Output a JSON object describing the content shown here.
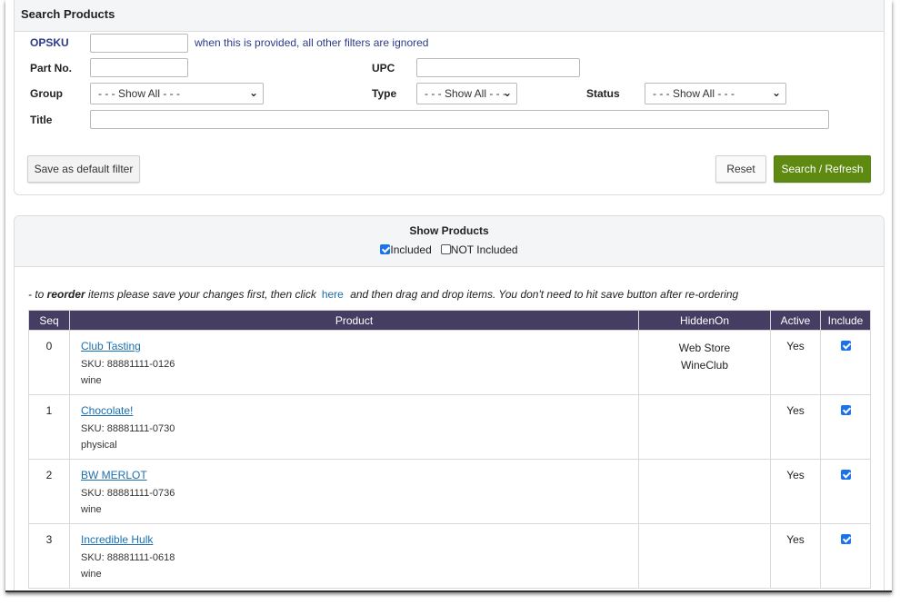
{
  "search": {
    "title": "Search Products",
    "opsku_label": "OPSKU",
    "opsku_value": "",
    "opsku_hint": "when this is provided, all other filters are ignored",
    "partno_label": "Part No.",
    "partno_value": "",
    "upc_label": "UPC",
    "upc_value": "",
    "group_label": "Group",
    "group_value": "- - - Show All - - -",
    "type_label": "Type",
    "type_value": "- - - Show All - - -",
    "status_label": "Status",
    "status_value": "- - - Show All - - -",
    "title_label": "Title",
    "title_value": "",
    "save_default_label": "Save as default filter",
    "reset_label": "Reset",
    "search_refresh_label": "Search / Refresh"
  },
  "products": {
    "title": "Show Products",
    "included_label": "Included",
    "included_checked": true,
    "not_included_label": "NOT Included",
    "not_included_checked": false,
    "reorder_prefix": "- to ",
    "reorder_bold": "reorder",
    "reorder_mid": " items please save your changes first, then click",
    "reorder_link": "here",
    "reorder_suffix": " and then drag and drop items. You don't need to hit save button after re-ordering",
    "columns": [
      "Seq",
      "Product",
      "HiddenOn",
      "Active",
      "Include"
    ],
    "rows": [
      {
        "seq": "0",
        "name": "Club Tasting",
        "sku": "SKU: 88881111-0126",
        "kind": "wine",
        "hidden": [
          "Web Store",
          "WineClub"
        ],
        "active": "Yes",
        "include": true
      },
      {
        "seq": "1",
        "name": "Chocolate!",
        "sku": "SKU: 88881111-0730",
        "kind": "physical",
        "hidden": [],
        "active": "Yes",
        "include": true
      },
      {
        "seq": "2",
        "name": "BW MERLOT",
        "sku": "SKU: 88881111-0736",
        "kind": "wine",
        "hidden": [],
        "active": "Yes",
        "include": true
      },
      {
        "seq": "3",
        "name": "Incredible Hulk",
        "sku": "SKU: 88881111-0618",
        "kind": "wine",
        "hidden": [],
        "active": "Yes",
        "include": true
      }
    ]
  },
  "colors": {
    "header_bg": "#463d63",
    "link": "#1a6fb0",
    "primary_button": "#5e8a12"
  }
}
